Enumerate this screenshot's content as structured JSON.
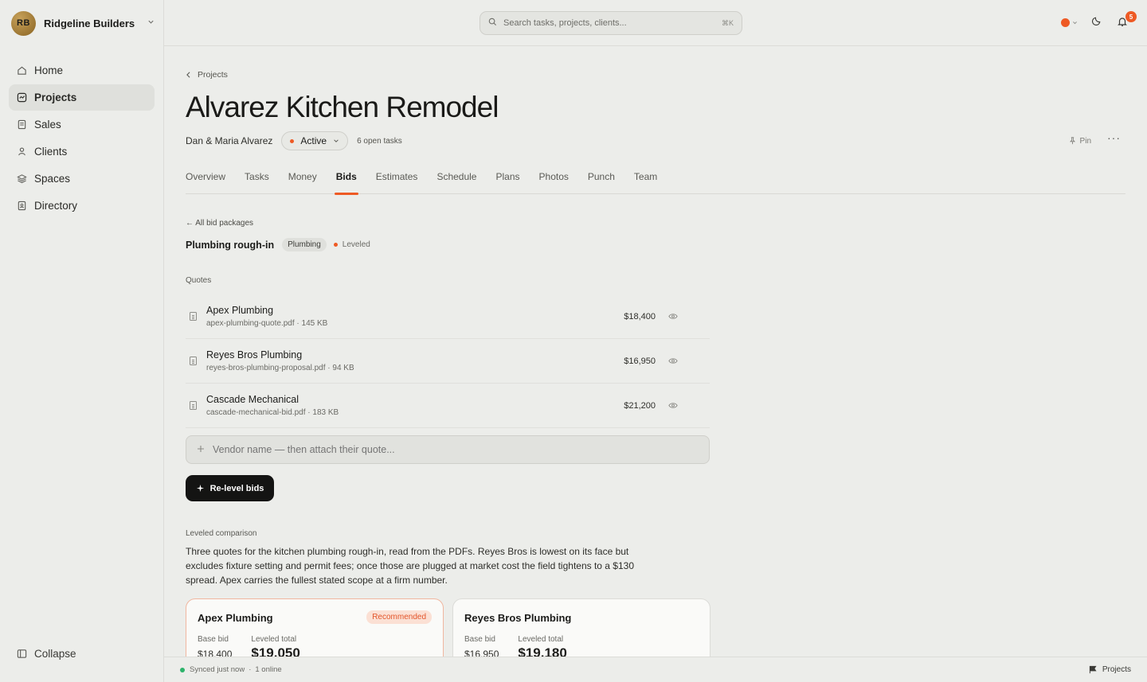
{
  "org": {
    "initials": "RB",
    "name": "Ridgeline Builders"
  },
  "nav": [
    {
      "label": "Home",
      "icon": "home-icon",
      "active": false
    },
    {
      "label": "Projects",
      "icon": "projects-icon",
      "active": true
    },
    {
      "label": "Sales",
      "icon": "sales-icon",
      "active": false
    },
    {
      "label": "Clients",
      "icon": "clients-icon",
      "active": false
    },
    {
      "label": "Spaces",
      "icon": "layers-icon",
      "active": false
    },
    {
      "label": "Directory",
      "icon": "directory-icon",
      "active": false
    }
  ],
  "collapse_label": "Collapse",
  "search": {
    "placeholder": "Search tasks, projects, clients...",
    "shortcut": "⌘K"
  },
  "notifications": {
    "count": "5"
  },
  "colors": {
    "accent": "#ee5a24",
    "success": "#2db36b",
    "primary_button": "#141413"
  },
  "project": {
    "breadcrumb": "Projects",
    "title": "Alvarez Kitchen Remodel",
    "client": "Dan & Maria Alvarez",
    "status": "Active",
    "open_tasks": "6 open tasks",
    "pin_label": "Pin"
  },
  "tabs": [
    "Overview",
    "Tasks",
    "Money",
    "Bids",
    "Estimates",
    "Schedule",
    "Plans",
    "Photos",
    "Punch",
    "Team"
  ],
  "active_tab": "Bids",
  "bid_package": {
    "back_label": "← All bid packages",
    "name": "Plumbing rough-in",
    "trade": "Plumbing",
    "state": "Leveled"
  },
  "quotes_label": "Quotes",
  "quotes": [
    {
      "vendor": "Apex Plumbing",
      "file": "apex-plumbing-quote.pdf · 145 KB",
      "amount": "$18,400"
    },
    {
      "vendor": "Reyes Bros Plumbing",
      "file": "reyes-bros-plumbing-proposal.pdf · 94 KB",
      "amount": "$16,950"
    },
    {
      "vendor": "Cascade Mechanical",
      "file": "cascade-mechanical-bid.pdf · 183 KB",
      "amount": "$21,200"
    }
  ],
  "vendor_input": {
    "placeholder": "Vendor name — then attach their quote..."
  },
  "relevel_label": "Re-level bids",
  "comparison": {
    "label": "Leveled comparison",
    "summary": "Three quotes for the kitchen plumbing rough-in, read from the PDFs. Reyes Bros is lowest on its face but excludes fixture setting and permit fees; once those are plugged at market cost the field tightens to a $130 spread. Apex carries the fullest stated scope at a firm number.",
    "cards": [
      {
        "vendor": "Apex Plumbing",
        "badge": "Recommended",
        "base_label": "Base bid",
        "base": "$18,400",
        "leveled_label": "Leveled total",
        "leveled": "$19,050"
      },
      {
        "vendor": "Reyes Bros Plumbing",
        "badge": "",
        "base_label": "Base bid",
        "base": "$16,950",
        "leveled_label": "Leveled total",
        "leveled": "$19,180"
      }
    ]
  },
  "statusbar": {
    "sync": "Synced just now",
    "online": "1 online",
    "right_label": "Projects"
  }
}
